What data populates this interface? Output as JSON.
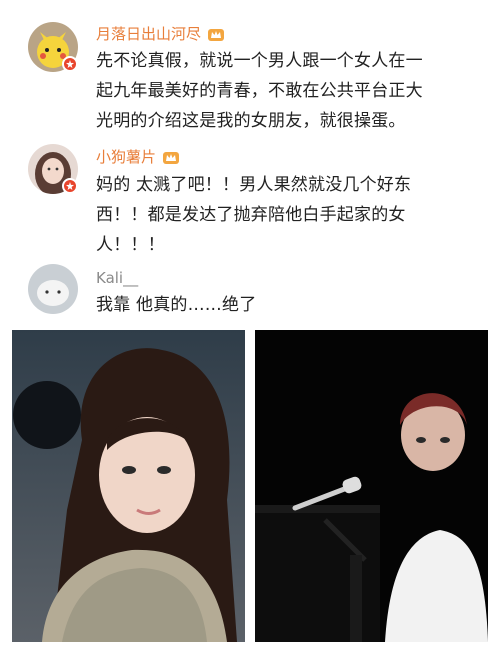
{
  "comments": [
    {
      "username": "月落日出山河尽",
      "lines": [
        "先不论真假，就说一个男人跟一个女人在一",
        "起九年最美好的青春，不敢在公共平台正大",
        "光明的介绍这是我的女朋友，就很操蛋。"
      ]
    },
    {
      "username": "小狗薯片",
      "lines": [
        "妈的 太溅了吧！！男人果然就没几个好东",
        "西！！都是发达了抛弃陪他白手起家的女",
        "人！！！"
      ]
    },
    {
      "username": "Kali__",
      "lines": [
        "我靠 他真的……绝了"
      ]
    }
  ],
  "colors": {
    "username": "#e87e3a",
    "username_plain": "#8a8a8a",
    "badge": "#e8452c",
    "text": "#222222"
  }
}
